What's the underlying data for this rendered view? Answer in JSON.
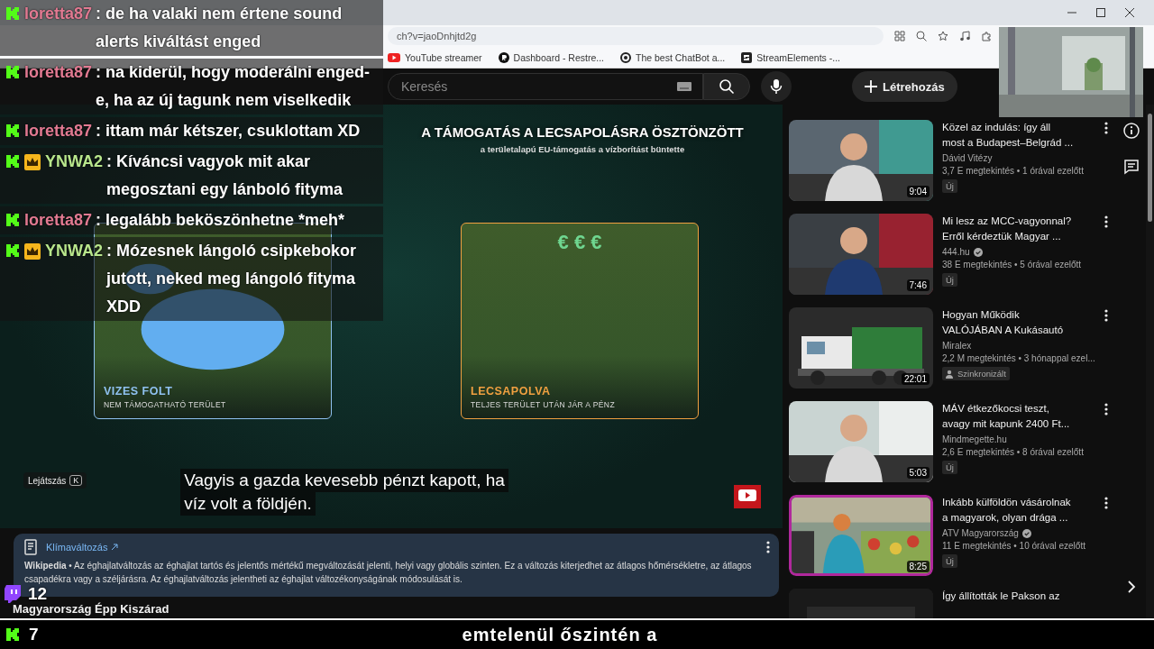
{
  "browser": {
    "url": "ch?v=jaoDnhjtd2g",
    "bookmarks": [
      {
        "kind": "youtube",
        "label": "YouTube streamer"
      },
      {
        "kind": "restream",
        "label": "Dashboard - Restre..."
      },
      {
        "kind": "chatbot",
        "label": "The best ChatBot a..."
      },
      {
        "kind": "streamelements",
        "label": "StreamElements -..."
      }
    ]
  },
  "masthead": {
    "search": {
      "placeholder": "Keresés"
    },
    "create_button": "Létrehozás"
  },
  "video": {
    "heading": "A TÁMOGATÁS A LECSAPOLÁSRA ÖSZTÖNZÖTT",
    "subheading": "a területalapú EU-támogatás a vízborítást büntette",
    "panels": [
      {
        "kind": "wet",
        "title": "VIZES FOLT",
        "caption": "NEM TÁMOGATHATÓ TERÜLET",
        "color": "#8fc1f0"
      },
      {
        "kind": "drained",
        "symbols": "€ € €",
        "title": "LECSAPOLVA",
        "caption": "TELJES TERÜLET UTÁN JÁR A PÉNZ",
        "color": "#f0a040"
      }
    ],
    "tooltip": {
      "label": "Lejátszás",
      "key": "K"
    },
    "captions": [
      "Vagyis a gazda kevesebb pénzt kapott, ha",
      "víz volt a földjén."
    ]
  },
  "info_panel": {
    "link": "Klímaváltozás",
    "text": "**Wikipedia** • Az éghajlatváltozás az éghajlat tartós és jelentős mértékű megváltozását jelenti, helyi vagy globális szinten. Ez a változás kiterjedhet az átlagos hőmérsékletre, az átlagos csapadékra vagy a széljárásra. Az éghajlatváltozás jelentheti az éghajlat változékonyságának módosulását is."
  },
  "video_title": "Magyarország Épp Kiszárad",
  "related": [
    {
      "title_lines": [
        "Közel az indulás: így áll",
        "most a Budapest–Belgrád ..."
      ],
      "channel": "Dávid Vitézy",
      "verified": false,
      "meta": "3,7 E megtekintés • 1 órával ezelőtt",
      "badge": {
        "kind": "new",
        "label": "Új"
      },
      "duration": "9:04",
      "highlighted": false
    },
    {
      "title_lines": [
        "Mi lesz az MCC-vagyonnal?",
        "Erről kérdeztük Magyar ..."
      ],
      "channel": "444.hu",
      "verified": true,
      "meta": "38 E megtekintés • 5 órával ezelőtt",
      "badge": {
        "kind": "new",
        "label": "Új"
      },
      "duration": "7:46",
      "highlighted": false
    },
    {
      "title_lines": [
        "Hogyan Működik",
        "VALÓJÁBAN A Kukásautó"
      ],
      "channel": "Miralex",
      "verified": false,
      "meta": "2,2 M megtekintés • 3 hónappal ezel...",
      "badge": {
        "kind": "dubbed",
        "label": "Szinkronizált"
      },
      "duration": "22:01",
      "highlighted": false
    },
    {
      "title_lines": [
        "MÁV étkezőkocsi teszt,",
        "avagy mit kapunk 2400 Ft..."
      ],
      "channel": "Mindmegette.hu",
      "verified": false,
      "meta": "2,6 E megtekintés • 8 órával ezelőtt",
      "badge": {
        "kind": "new",
        "label": "Új"
      },
      "duration": "5:03",
      "highlighted": false
    },
    {
      "title_lines": [
        "Inkább külföldön vásárolnak",
        "a magyarok, olyan drága ..."
      ],
      "channel": "ATV Magyarország",
      "verified": true,
      "meta": "11 E megtekintés • 10 órával ezelőtt",
      "badge": {
        "kind": "new",
        "label": "Új"
      },
      "duration": "8:25",
      "highlighted": true
    },
    {
      "title_lines": [
        "Így állították le Pakson az"
      ],
      "highlighted": false
    }
  ],
  "chat": [
    {
      "crown": false,
      "user": "loretta87",
      "color": "#e27a92",
      "text": ": de ha valaki nem értene sound alerts kiváltást enged"
    },
    {
      "crown": false,
      "user": "loretta87",
      "color": "#e27a92",
      "text": ": na kiderül, hogy moderálni enged-e, ha az új tagunk nem viselkedik"
    },
    {
      "crown": false,
      "user": "loretta87",
      "color": "#e27a92",
      "text": ": ittam már kétszer, csuklottam XD"
    },
    {
      "crown": true,
      "user": "YNWA2",
      "color": "#b8e68c",
      "text": ": Kíváncsi vagyok mit akar megosztani egy lánboló fityma"
    },
    {
      "crown": false,
      "user": "loretta87",
      "color": "#e27a92",
      "text": ": legalább beköszönhetne *meh*"
    },
    {
      "crown": true,
      "user": "YNWA2",
      "color": "#b8e68c",
      "text": ": Mózesnek lángoló csipkebokor jutott, neked meg lángoló fityma XDD"
    }
  ],
  "overlay": {
    "twitch_viewers": "12",
    "kick_viewers": "7",
    "ticker": "emtelenül őszintén a"
  }
}
